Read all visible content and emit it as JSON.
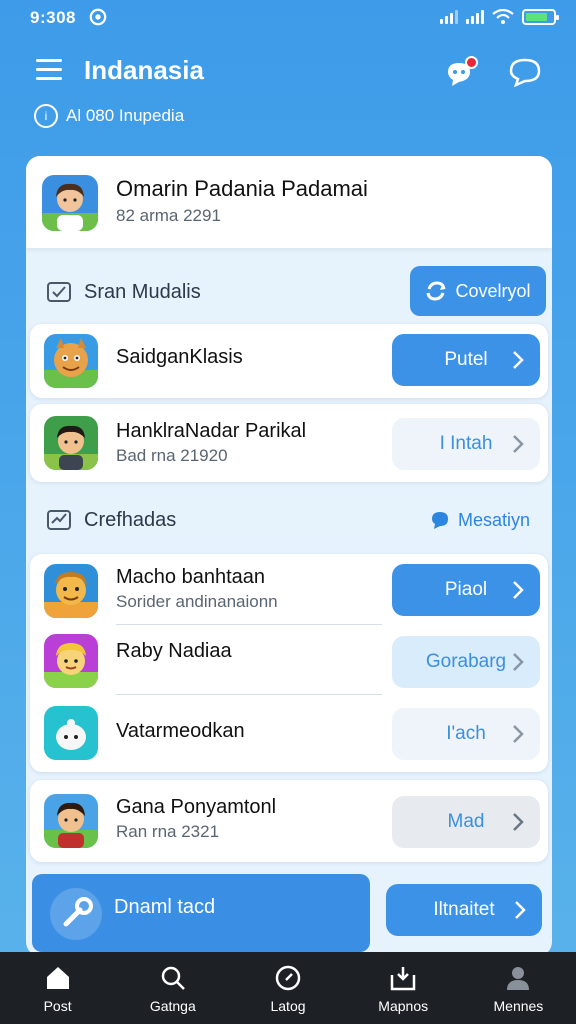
{
  "status": {
    "time": "9:308"
  },
  "header": {
    "title": "Indanasia",
    "subline": "Al 080 Inupedia"
  },
  "profile": {
    "name": "Omarin Padania Padamai",
    "sub": "82 arma 2291"
  },
  "section1": {
    "title": "Sran Mudalis",
    "button": "Covelryol",
    "items": [
      {
        "title": "SaidganKlasis",
        "sub": "",
        "action": "Putel"
      },
      {
        "title": "HanklraNadar Parikal",
        "sub": "Bad rna 21920",
        "action": "I Intah"
      }
    ]
  },
  "section2": {
    "title": "Crefhadas",
    "link": "Mesatiyn",
    "items": [
      {
        "title": "Macho banhtaan",
        "sub": "Sorider andinanaionn",
        "action": "Piaol"
      },
      {
        "title": "Raby Nadiaa",
        "sub": "",
        "action": "Gorabarg"
      },
      {
        "title": "Vatarmeodkan",
        "sub": "",
        "action": "I'ach"
      }
    ]
  },
  "section3": {
    "items": [
      {
        "title": "Gana Ponyamtonl",
        "sub": "Ran rna 2321",
        "action": "Mad"
      }
    ]
  },
  "promo": {
    "title": "Dnaml tacd",
    "button": "Iltnaitet"
  },
  "tabs": [
    {
      "label": "Post",
      "icon": "home-icon"
    },
    {
      "label": "Gatnga",
      "icon": "search-icon"
    },
    {
      "label": "Latog",
      "icon": "compass-icon"
    },
    {
      "label": "Mapnos",
      "icon": "inbox-icon"
    },
    {
      "label": "Mennes",
      "icon": "profile-icon"
    }
  ],
  "colors": {
    "primary": "#3b92e6",
    "background_top": "#3d9be9",
    "tabbar": "#1d2126",
    "notification": "#e8283a",
    "battery": "#5ee27a"
  }
}
